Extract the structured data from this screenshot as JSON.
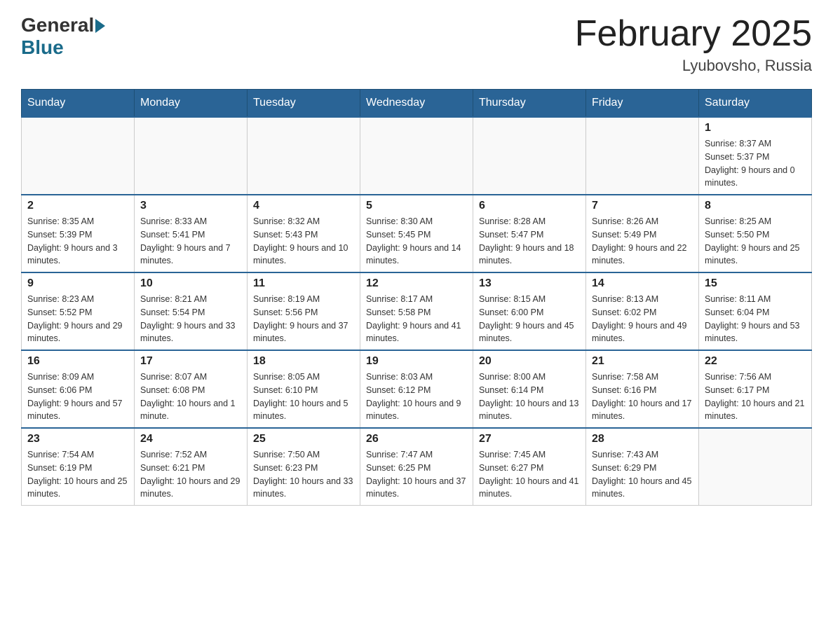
{
  "logo": {
    "general": "General",
    "blue": "Blue"
  },
  "title": "February 2025",
  "location": "Lyubovsho, Russia",
  "days_of_week": [
    "Sunday",
    "Monday",
    "Tuesday",
    "Wednesday",
    "Thursday",
    "Friday",
    "Saturday"
  ],
  "weeks": [
    [
      {
        "day": "",
        "info": ""
      },
      {
        "day": "",
        "info": ""
      },
      {
        "day": "",
        "info": ""
      },
      {
        "day": "",
        "info": ""
      },
      {
        "day": "",
        "info": ""
      },
      {
        "day": "",
        "info": ""
      },
      {
        "day": "1",
        "info": "Sunrise: 8:37 AM\nSunset: 5:37 PM\nDaylight: 9 hours and 0 minutes."
      }
    ],
    [
      {
        "day": "2",
        "info": "Sunrise: 8:35 AM\nSunset: 5:39 PM\nDaylight: 9 hours and 3 minutes."
      },
      {
        "day": "3",
        "info": "Sunrise: 8:33 AM\nSunset: 5:41 PM\nDaylight: 9 hours and 7 minutes."
      },
      {
        "day": "4",
        "info": "Sunrise: 8:32 AM\nSunset: 5:43 PM\nDaylight: 9 hours and 10 minutes."
      },
      {
        "day": "5",
        "info": "Sunrise: 8:30 AM\nSunset: 5:45 PM\nDaylight: 9 hours and 14 minutes."
      },
      {
        "day": "6",
        "info": "Sunrise: 8:28 AM\nSunset: 5:47 PM\nDaylight: 9 hours and 18 minutes."
      },
      {
        "day": "7",
        "info": "Sunrise: 8:26 AM\nSunset: 5:49 PM\nDaylight: 9 hours and 22 minutes."
      },
      {
        "day": "8",
        "info": "Sunrise: 8:25 AM\nSunset: 5:50 PM\nDaylight: 9 hours and 25 minutes."
      }
    ],
    [
      {
        "day": "9",
        "info": "Sunrise: 8:23 AM\nSunset: 5:52 PM\nDaylight: 9 hours and 29 minutes."
      },
      {
        "day": "10",
        "info": "Sunrise: 8:21 AM\nSunset: 5:54 PM\nDaylight: 9 hours and 33 minutes."
      },
      {
        "day": "11",
        "info": "Sunrise: 8:19 AM\nSunset: 5:56 PM\nDaylight: 9 hours and 37 minutes."
      },
      {
        "day": "12",
        "info": "Sunrise: 8:17 AM\nSunset: 5:58 PM\nDaylight: 9 hours and 41 minutes."
      },
      {
        "day": "13",
        "info": "Sunrise: 8:15 AM\nSunset: 6:00 PM\nDaylight: 9 hours and 45 minutes."
      },
      {
        "day": "14",
        "info": "Sunrise: 8:13 AM\nSunset: 6:02 PM\nDaylight: 9 hours and 49 minutes."
      },
      {
        "day": "15",
        "info": "Sunrise: 8:11 AM\nSunset: 6:04 PM\nDaylight: 9 hours and 53 minutes."
      }
    ],
    [
      {
        "day": "16",
        "info": "Sunrise: 8:09 AM\nSunset: 6:06 PM\nDaylight: 9 hours and 57 minutes."
      },
      {
        "day": "17",
        "info": "Sunrise: 8:07 AM\nSunset: 6:08 PM\nDaylight: 10 hours and 1 minute."
      },
      {
        "day": "18",
        "info": "Sunrise: 8:05 AM\nSunset: 6:10 PM\nDaylight: 10 hours and 5 minutes."
      },
      {
        "day": "19",
        "info": "Sunrise: 8:03 AM\nSunset: 6:12 PM\nDaylight: 10 hours and 9 minutes."
      },
      {
        "day": "20",
        "info": "Sunrise: 8:00 AM\nSunset: 6:14 PM\nDaylight: 10 hours and 13 minutes."
      },
      {
        "day": "21",
        "info": "Sunrise: 7:58 AM\nSunset: 6:16 PM\nDaylight: 10 hours and 17 minutes."
      },
      {
        "day": "22",
        "info": "Sunrise: 7:56 AM\nSunset: 6:17 PM\nDaylight: 10 hours and 21 minutes."
      }
    ],
    [
      {
        "day": "23",
        "info": "Sunrise: 7:54 AM\nSunset: 6:19 PM\nDaylight: 10 hours and 25 minutes."
      },
      {
        "day": "24",
        "info": "Sunrise: 7:52 AM\nSunset: 6:21 PM\nDaylight: 10 hours and 29 minutes."
      },
      {
        "day": "25",
        "info": "Sunrise: 7:50 AM\nSunset: 6:23 PM\nDaylight: 10 hours and 33 minutes."
      },
      {
        "day": "26",
        "info": "Sunrise: 7:47 AM\nSunset: 6:25 PM\nDaylight: 10 hours and 37 minutes."
      },
      {
        "day": "27",
        "info": "Sunrise: 7:45 AM\nSunset: 6:27 PM\nDaylight: 10 hours and 41 minutes."
      },
      {
        "day": "28",
        "info": "Sunrise: 7:43 AM\nSunset: 6:29 PM\nDaylight: 10 hours and 45 minutes."
      },
      {
        "day": "",
        "info": ""
      }
    ]
  ]
}
